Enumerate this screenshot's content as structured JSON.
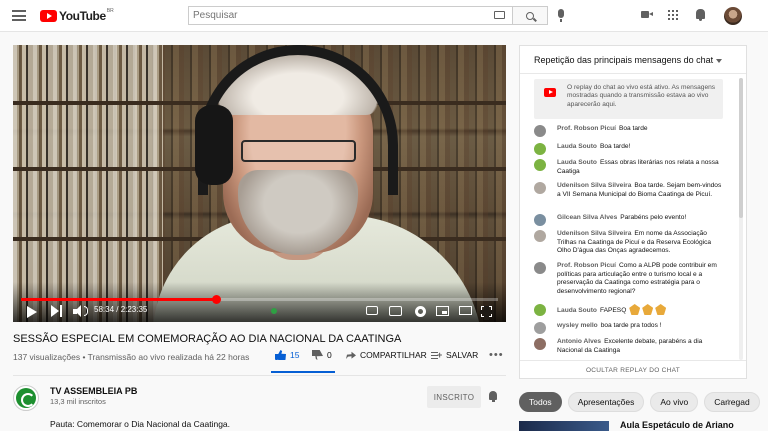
{
  "header": {
    "logo_text": "YouTube",
    "logo_country": "BR",
    "search_placeholder": "Pesquisar"
  },
  "player": {
    "time_current": "58:34",
    "time_total": "2:23:35",
    "time_display": "58:34 / 2:23:35",
    "progress_fraction": 0.408
  },
  "video": {
    "title": "SESSÃO ESPECIAL EM COMEMORAÇÃO AO DIA NACIONAL DA CAATINGA",
    "meta": "137 visualizações • Transmissão ao vivo realizada há 22 horas",
    "likes": "15",
    "dislikes": "0",
    "share_label": "COMPARTILHAR",
    "save_label": "SALVAR"
  },
  "channel": {
    "name": "TV ASSEMBLEIA PB",
    "subscribers": "13,3 mil inscritos",
    "subscribe_label": "INSCRITO",
    "description": "Pauta: Comemorar o Dia Nacional da Caatinga."
  },
  "chat": {
    "title": "Repetição das principais mensagens do chat",
    "notice": "O replay do chat ao vivo está ativo. As mensagens mostradas quando a transmissão estava ao vivo aparecerão aqui.",
    "footer": "OCULTAR REPLAY DO CHAT",
    "messages": [
      {
        "author": "Prof. Robson Picuí",
        "text": "Boa tarde",
        "color": "#8a8a8a"
      },
      {
        "author": "Lauda Souto",
        "text": "Boa tarde!",
        "color": "#7cb342"
      },
      {
        "author": "Lauda Souto",
        "text": "Essas obras literárias nos relata a nossa Caatiga",
        "color": "#7cb342"
      },
      {
        "author": "Udenilson Silva Silveira",
        "text": "Boa tarde. Sejam bem-vindos a VII Semana Municipal do Bioma Caatinga de Picuí.",
        "color": "#b0a8a0"
      },
      {
        "author": "Gilcean Silva Alves",
        "text": "Parabéns pelo evento!",
        "color": "#7a8fa0"
      },
      {
        "author": "Udenilson Silva Silveira",
        "text": "Em nome da Associação Trilhas na Caatinga de Picuí e da Reserva Ecológica Olho D'água das Onças agradecemos.",
        "color": "#b0a8a0"
      },
      {
        "author": "Prof. Robson Picuí",
        "text": "Como a ALPB pode contribuir em políticas para articulação entre o turismo local e a preservação da Caatinga como estratégia para o desenvolvimento regional?",
        "color": "#8a8a8a"
      },
      {
        "author": "Lauda Souto",
        "text": "FAPESQ",
        "color": "#7cb342"
      },
      {
        "author": "wysley mello",
        "text": "boa tarde pra todos !",
        "color": "#9e9e9e"
      },
      {
        "author": "Antonio Alves",
        "text": "Excelente debate, parabéns a dia Nacional da Caatinga",
        "color": "#8d6e63"
      }
    ]
  },
  "chips": [
    "Todos",
    "Apresentações",
    "Ao vivo",
    "Carregad"
  ],
  "recommendation": {
    "title": "Aula Espetáculo de Ariano"
  }
}
